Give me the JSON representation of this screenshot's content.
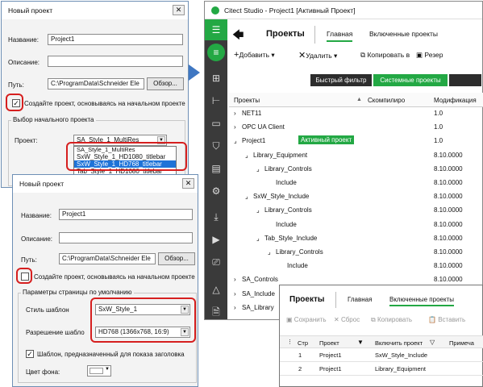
{
  "dialog1": {
    "title": "Новый проект",
    "close": "✕",
    "name_label": "Название:",
    "name_value": "Project1",
    "desc_label": "Описание:",
    "path_label": "Путь:",
    "path_value": "C:\\ProgramData\\Schneider Ele",
    "browse": "Обзор...",
    "checkbox_label": "Создайте проект, основываясь на начальном проекте",
    "checked": "✓",
    "group_label": "Выбор начального проекта",
    "project_label": "Проект:",
    "project_value": "SA_Style_1_MultiRes",
    "options": [
      "SA_Style_1_MultiRes",
      "SxW_Style_1_HD1080_titlebar",
      "SxW_Style_1_HD768_titlebar",
      "Tab_Style_1_HD1080_titlebar"
    ]
  },
  "dialog2": {
    "title": "Новый проект",
    "close": "✕",
    "name_label": "Название:",
    "name_value": "Project1",
    "desc_label": "Описание:",
    "path_label": "Путь:",
    "path_value": "C:\\ProgramData\\Schneider Ele",
    "browse": "Обзор...",
    "checkbox_label": "Создайте проект, основываясь на начальном проекте",
    "group_label": "Параметры страницы по умолчанию",
    "style_label": "Стиль шаблон",
    "style_value": "SxW_Style_1",
    "res_label": "Разрешение шабло",
    "res_value": "HD768 (1366x768, 16:9)",
    "titlebar_label": "Шаблон, предназначенный для показа заголовка",
    "checked": "✓",
    "bg_label": "Цвет фона:"
  },
  "studio": {
    "title": "Citect Studio - Project1 [Активный Проект]",
    "back": "🡄",
    "heading": "Проекты",
    "tab_main": "Главная",
    "tab_included": "Включенные проекты",
    "add": "Добавить",
    "delete": "Удалить",
    "copy": "Копировать в",
    "reserve": "Резер",
    "quick_filter": "Быстрый фильтр",
    "system_projects": "Системные проекты",
    "col_projects": "Проекты",
    "col_compiled": "Скомпилиро",
    "col_modified": "Модификация",
    "rows": [
      {
        "indent": 0,
        "arrow": "›",
        "name": "NET11",
        "version": "1.0"
      },
      {
        "indent": 0,
        "arrow": "›",
        "name": "OPC UA Client",
        "version": "1.0"
      },
      {
        "indent": 0,
        "arrow": "⌟",
        "name": "Project1",
        "version": "1.0",
        "badge": "Активный проект"
      },
      {
        "indent": 1,
        "arrow": "⌟",
        "name": "Library_Equipment",
        "version": "8.10.0000"
      },
      {
        "indent": 2,
        "arrow": "⌟",
        "name": "Library_Controls",
        "version": "8.10.0000"
      },
      {
        "indent": 3,
        "arrow": "",
        "name": "Include",
        "version": "8.10.0000"
      },
      {
        "indent": 1,
        "arrow": "⌟",
        "name": "SxW_Style_Include",
        "version": "8.10.0000"
      },
      {
        "indent": 2,
        "arrow": "⌟",
        "name": "Library_Controls",
        "version": "8.10.0000"
      },
      {
        "indent": 3,
        "arrow": "",
        "name": "Include",
        "version": "8.10.0000"
      },
      {
        "indent": 2,
        "arrow": "⌟",
        "name": "Tab_Style_Include",
        "version": "8.10.0000"
      },
      {
        "indent": 3,
        "arrow": "⌟",
        "name": "Library_Controls",
        "version": "8.10.0000"
      },
      {
        "indent": 4,
        "arrow": "",
        "name": "Include",
        "version": "8.10.0000"
      },
      {
        "indent": 0,
        "arrow": "›",
        "name": "SA_Controls",
        "version": "8.10.0000"
      },
      {
        "indent": 0,
        "arrow": "›",
        "name": "SA_Include",
        "version": ""
      },
      {
        "indent": 0,
        "arrow": "›",
        "name": "SA_Library",
        "version": ""
      }
    ]
  },
  "panel": {
    "heading": "Проекты",
    "tab_main": "Главная",
    "tab_included": "Включенные проекты",
    "save": "Сохранить",
    "reset": "Сброс",
    "copy": "Копировать",
    "paste": "Вставить",
    "col_num": "Стр",
    "col_project": "Проект",
    "col_include": "Включить проект",
    "col_note": "Примеча",
    "rows": [
      {
        "n": "1",
        "project": "Project1",
        "include": "SxW_Style_Include"
      },
      {
        "n": "2",
        "project": "Project1",
        "include": "Library_Equipment"
      }
    ]
  },
  "colors": {
    "accent_green": "#23a844",
    "sidebar": "#3a3a3a",
    "highlight": "#3c7fd9",
    "red_marker": "#d61f1f"
  }
}
